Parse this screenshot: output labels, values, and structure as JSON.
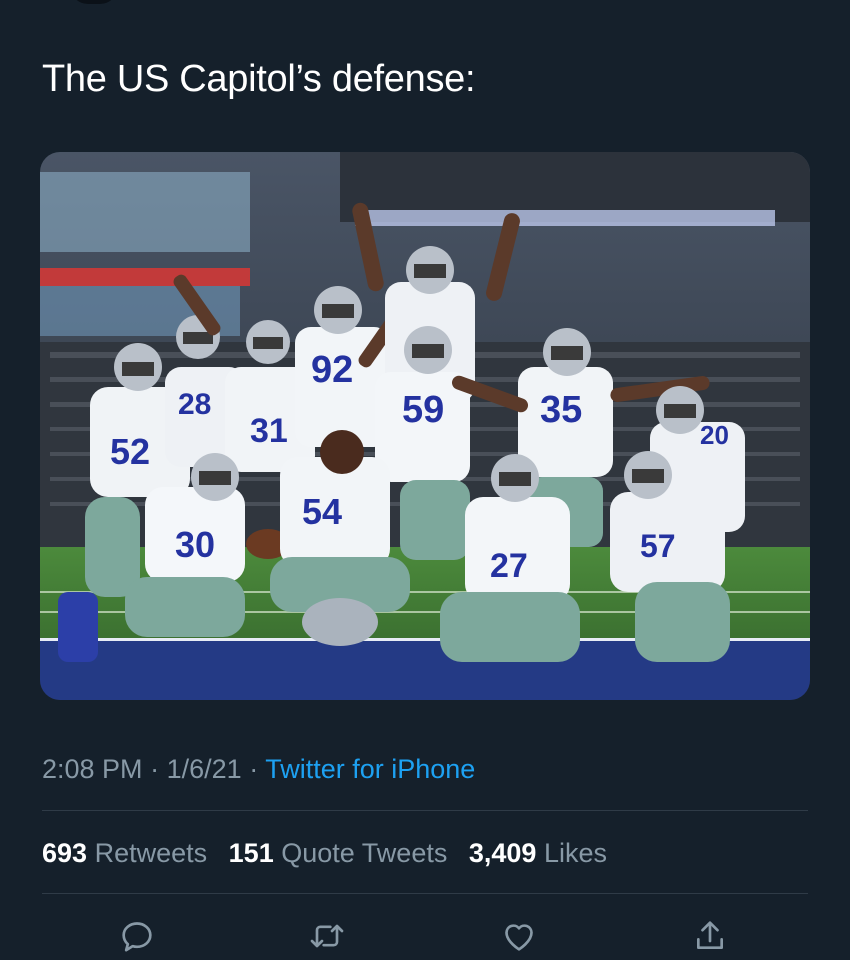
{
  "tweet": {
    "text": "The US Capitol’s defense:",
    "time": "2:08 PM",
    "date": "1/6/21",
    "separator": "·",
    "source": "Twitter for iPhone"
  },
  "photo": {
    "jersey_numbers": [
      "92",
      "59",
      "35",
      "31",
      "28",
      "52",
      "20",
      "54",
      "30",
      "27",
      "57"
    ]
  },
  "stats": {
    "retweets_count": "693",
    "retweets_label": "Retweets",
    "quotes_count": "151",
    "quotes_label": "Quote Tweets",
    "likes_count": "3,409",
    "likes_label": "Likes"
  },
  "actions": {
    "icons": [
      "reply-icon",
      "retweet-icon",
      "like-icon",
      "share-icon"
    ]
  },
  "colors": {
    "background": "#15202b",
    "text": "#ffffff",
    "secondary": "#8899a6",
    "link": "#1da1f2",
    "divider": "#2f3b47"
  }
}
